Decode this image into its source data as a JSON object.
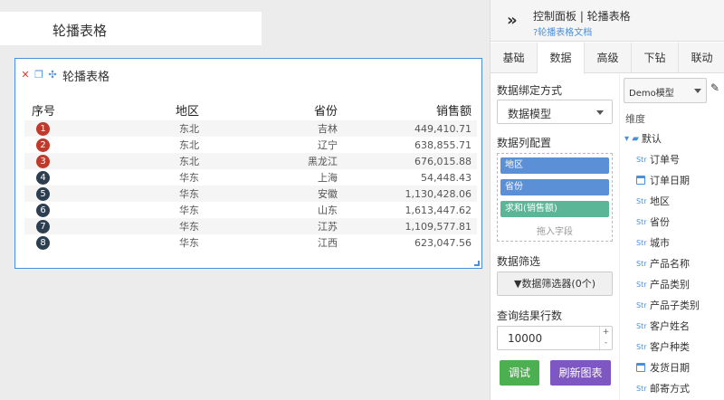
{
  "canvas": {
    "title_card": "轮播表格",
    "widget": {
      "title": "轮播表格",
      "columns": [
        "序号",
        "地区",
        "省份",
        "销售额"
      ],
      "rows": [
        {
          "rank": "1",
          "region": "东北",
          "province": "吉林",
          "sales": "449,410.71",
          "badge": "red"
        },
        {
          "rank": "2",
          "region": "东北",
          "province": "辽宁",
          "sales": "638,855.71",
          "badge": "red"
        },
        {
          "rank": "3",
          "region": "东北",
          "province": "黑龙江",
          "sales": "676,015.88",
          "badge": "red"
        },
        {
          "rank": "4",
          "region": "华东",
          "province": "上海",
          "sales": "54,448.43",
          "badge": "dark"
        },
        {
          "rank": "5",
          "region": "华东",
          "province": "安徽",
          "sales": "1,130,428.06",
          "badge": "dark"
        },
        {
          "rank": "6",
          "region": "华东",
          "province": "山东",
          "sales": "1,613,447.62",
          "badge": "dark"
        },
        {
          "rank": "7",
          "region": "华东",
          "province": "江苏",
          "sales": "1,109,577.81",
          "badge": "dark"
        },
        {
          "rank": "8",
          "region": "华东",
          "province": "江西",
          "sales": "623,047.56",
          "badge": "dark"
        }
      ]
    }
  },
  "panel": {
    "header": {
      "title": "控制面板 | 轮播表格",
      "doc_link": "?轮播表格文档"
    },
    "tabs": [
      "基础",
      "数据",
      "高级",
      "下钻",
      "联动"
    ],
    "active_tab": "数据",
    "binding_label": "数据绑定方式",
    "binding_value": "数据模型",
    "columns_label": "数据列配置",
    "fields": [
      "地区",
      "省份",
      "求和(销售额)"
    ],
    "drop_hint": "拖入字段",
    "filter_label": "数据筛选",
    "filter_button": "数据筛选器(0个)",
    "rows_label": "查询结果行数",
    "rows_value": "10000",
    "debug_button": "调试",
    "refresh_button": "刷新图表",
    "model_select": "Demo模型",
    "dimension_label": "维度",
    "folder": "默认",
    "dimensions": [
      {
        "type": "Str",
        "name": "订单号"
      },
      {
        "type": "date",
        "name": "订单日期"
      },
      {
        "type": "Str",
        "name": "地区"
      },
      {
        "type": "Str",
        "name": "省份"
      },
      {
        "type": "Str",
        "name": "城市"
      },
      {
        "type": "Str",
        "name": "产品名称"
      },
      {
        "type": "Str",
        "name": "产品类别"
      },
      {
        "type": "Str",
        "name": "产品子类别"
      },
      {
        "type": "Str",
        "name": "客户姓名"
      },
      {
        "type": "Str",
        "name": "客户种类"
      },
      {
        "type": "date",
        "name": "发货日期"
      },
      {
        "type": "Str",
        "name": "邮寄方式"
      }
    ]
  }
}
